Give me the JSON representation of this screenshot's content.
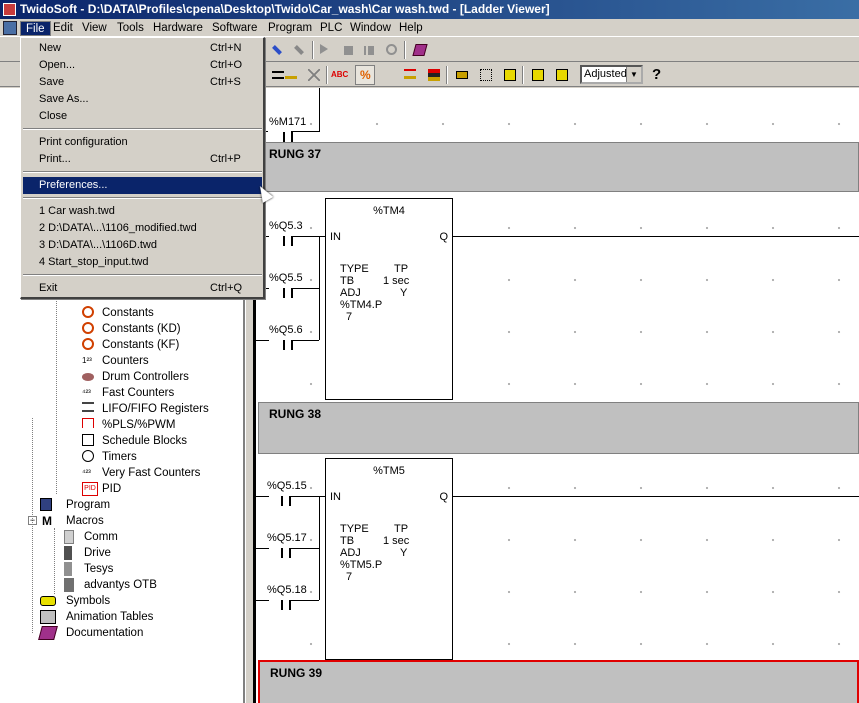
{
  "window": {
    "title": "TwidoSoft - D:\\DATA\\Profiles\\cpena\\Desktop\\Twido\\Car_wash\\Car wash.twd - [Ladder Viewer]"
  },
  "menubar": [
    "File",
    "Edit",
    "View",
    "Tools",
    "Hardware",
    "Software",
    "Program",
    "PLC",
    "Window",
    "Help"
  ],
  "toolbar": {
    "zoom_value": "Adjusted",
    "help_icon": "?"
  },
  "file_menu": {
    "group1": [
      {
        "label": "New",
        "shortcut": "Ctrl+N"
      },
      {
        "label": "Open...",
        "shortcut": "Ctrl+O"
      },
      {
        "label": "Save",
        "shortcut": "Ctrl+S"
      },
      {
        "label": "Save As...",
        "shortcut": ""
      },
      {
        "label": "Close",
        "shortcut": ""
      }
    ],
    "group2": [
      {
        "label": "Print configuration",
        "shortcut": ""
      },
      {
        "label": "Print...",
        "shortcut": "Ctrl+P"
      }
    ],
    "group3": [
      {
        "label": "Preferences...",
        "shortcut": ""
      }
    ],
    "recent": [
      "1 Car wash.twd",
      "2 D:\\DATA\\...\\1106_modified.twd",
      "3 D:\\DATA\\...\\1106D.twd",
      "4 Start_stop_input.twd"
    ],
    "exit": {
      "label": "Exit",
      "shortcut": "Ctrl+Q"
    }
  },
  "tree": {
    "software_items": [
      "Constants",
      "Constants (KD)",
      "Constants (KF)",
      "Counters",
      "Drum Controllers",
      "Fast Counters",
      "LIFO/FIFO Registers",
      "%PLS/%PWM",
      "Schedule Blocks",
      "Timers",
      "Very Fast Counters",
      "PID"
    ],
    "program": "Program",
    "macros": "Macros",
    "macro_items": [
      "Comm",
      "Drive",
      "Tesys",
      "advantys OTB"
    ],
    "bottom_items": [
      "Symbols",
      "Animation Tables",
      "Documentation"
    ]
  },
  "ladder": {
    "top_contact": "%M171",
    "rungs": [
      {
        "label": "RUNG 37",
        "block": "%TM4",
        "contacts": [
          "%Q5.3",
          "%Q5.5",
          "%Q5.6"
        ],
        "type": "TP",
        "tb": "1 sec",
        "adj": "Y",
        "preset_name": "%TM4.P",
        "preset": "7"
      },
      {
        "label": "RUNG 38",
        "block": "%TM5",
        "contacts": [
          "%Q5.15",
          "%Q5.17",
          "%Q5.18"
        ],
        "type": "TP",
        "tb": "1 sec",
        "adj": "Y",
        "preset_name": "%TM5.P",
        "preset": "7"
      },
      {
        "label": "RUNG 39"
      }
    ],
    "param_labels": {
      "type": "TYPE",
      "tb": "TB",
      "adj": "ADJ",
      "in": "IN",
      "q": "Q"
    }
  }
}
